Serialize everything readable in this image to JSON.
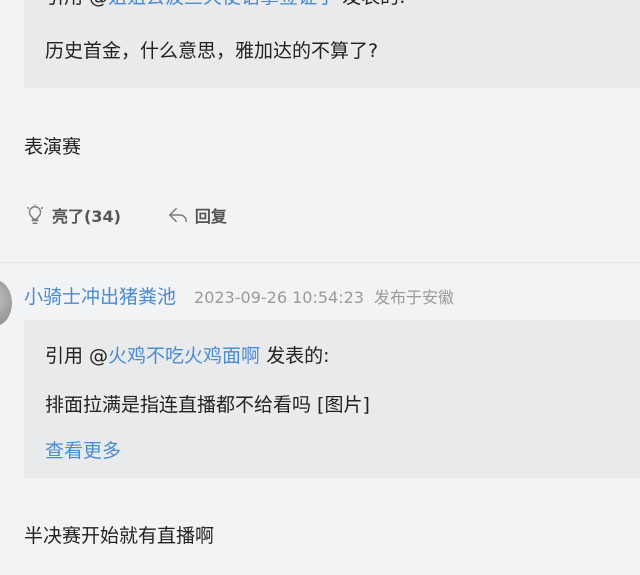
{
  "post1": {
    "quote": {
      "prefix": "引用 @",
      "user": "姐姐去波兰天使语掌签证了",
      "suffix": " 发表的:",
      "text": "历史首金，什么意思，雅加达的不算了?"
    },
    "body": "表演赛",
    "actions": {
      "like_label": "亮了(34)",
      "reply_label": "回复"
    }
  },
  "post2": {
    "username": "小骑士冲出猪粪池",
    "time": "2023-09-26 10:54:23",
    "location": "发布于安徽",
    "quote": {
      "prefix": "引用 @",
      "user": "火鸡不吃火鸡面啊",
      "suffix": " 发表的:",
      "text": "排面拉满是指连直播都不给看吗 [图片]",
      "more": "查看更多"
    },
    "body": "半决赛开始就有直播啊"
  },
  "icons": {
    "like": "lightbulb-icon",
    "reply": "reply-arrow-icon"
  }
}
